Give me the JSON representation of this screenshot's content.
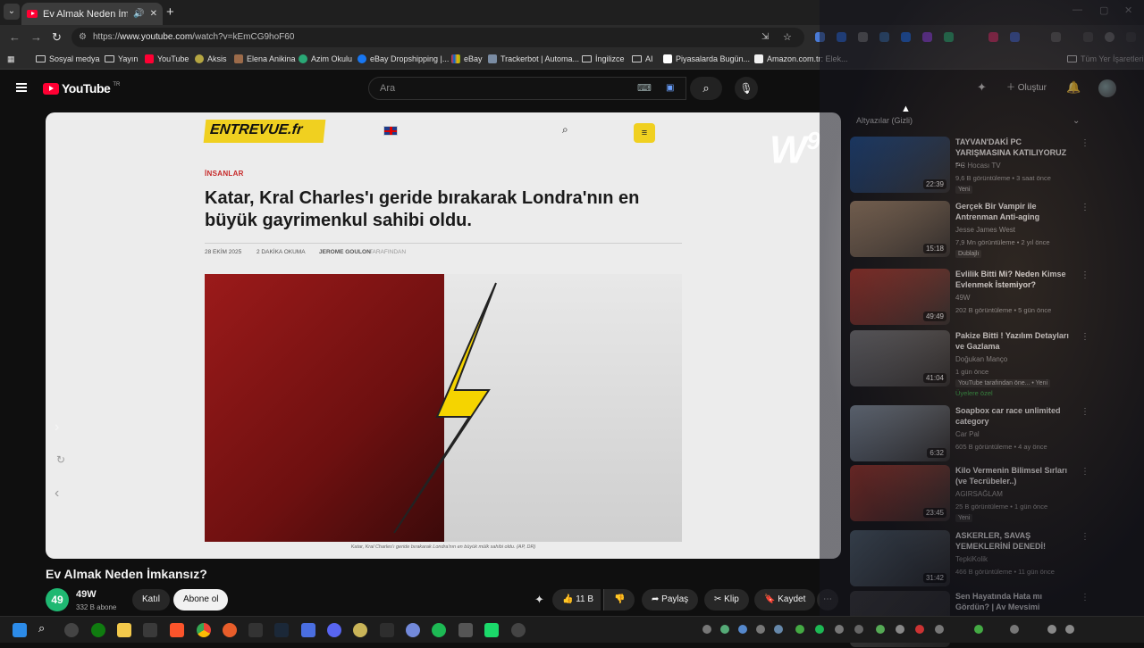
{
  "browser": {
    "tab_title": "Ev Almak Neden İmkansız?",
    "url_prefix": "https://",
    "url_domain": "www.youtube.com",
    "url_path": "/watch?v=kEmCG9hoF60",
    "bookmarks": [
      {
        "label": "Sosyal medya"
      },
      {
        "label": "Yayın"
      },
      {
        "label": "YouTube"
      },
      {
        "label": "Aksis"
      },
      {
        "label": "Elena Anikina"
      },
      {
        "label": "Azim Okulu"
      },
      {
        "label": "eBay Dropshipping |..."
      },
      {
        "label": "eBay"
      },
      {
        "label": "Trackerbot | Automa..."
      },
      {
        "label": "İngilizce"
      },
      {
        "label": "AI"
      },
      {
        "label": "Piyasalarda Bugün..."
      },
      {
        "label": "Amazon.com.tr: Elek..."
      },
      {
        "label": "Tüm Yer İşaretleri"
      }
    ]
  },
  "youtube": {
    "logo_text": "YouTube",
    "logo_region": "TR",
    "search_placeholder": "Ara",
    "create_label": "Oluştur"
  },
  "article": {
    "site_name": "ENTREVUE.fr",
    "category": "İNSANLAR",
    "headline": "Katar, Kral Charles'ı geride bırakarak Londra'nın en büyük gayrimenkul sahibi oldu.",
    "date": "28 EKİM 2025",
    "read_time": "2 DAKİKA OKUMA",
    "author": "JEROME GOULON",
    "author_suffix": "TARAFINDAN",
    "caption": "Katar, Kral Charles'ı geride bırakarak Londra'nın en büyük mülk sahibi oldu. (AP, DR)"
  },
  "video": {
    "title": "Ev Almak Neden İmkansız?",
    "channel_initials": "49",
    "channel_name": "49W",
    "subscribers": "332 B abone",
    "join_label": "Katıl",
    "subscribe_label": "Abone ol",
    "likes": "11 B",
    "share_label": "Paylaş",
    "clip_label": "Klip",
    "save_label": "Kaydet"
  },
  "sidebar": {
    "header": "Altyazılar (Gizli)",
    "items": [
      {
        "title": "TAYVAN'DAKİ PC YARIŞMASINA KATILIYORUZ -...",
        "channel": "PC Hocası TV",
        "meta": "9,6 B görüntüleme • 3 saat önce",
        "badge": "Yeni",
        "duration": "22:39",
        "thumb_color": "#1e5aa8"
      },
      {
        "title": "Gerçek Bir Vampir ile Antrenman Anti-aging",
        "channel": "Jesse James West",
        "meta": "7,9 Mn görüntüleme • 2 yıl önce",
        "badge": "Dublajlı",
        "duration": "15:18",
        "thumb_color": "#c8a27a"
      },
      {
        "title": "Evlilik Bitti Mi? Neden Kimse Evlenmek İstemiyor?",
        "channel": "49W",
        "meta": "202 B görüntüleme • 5 gün önce",
        "badge": "",
        "duration": "49:49",
        "thumb_color": "#d13a2a"
      },
      {
        "title": "Pakize Bitti ! Yazılım Detayları ve Gazlama",
        "channel": "Doğukan Manço",
        "meta": "1 gün önce",
        "badge": "YouTube tarafından öne... • Yeni",
        "extra": "Üyelere özel",
        "duration": "41:04",
        "thumb_color": "#8a8a8a"
      },
      {
        "title": "Soapbox car race unlimited category",
        "channel": "Car Pal",
        "meta": "605 B görüntüleme • 4 ay önce",
        "badge": "",
        "duration": "6:32",
        "thumb_color": "#9fb0bf"
      },
      {
        "title": "Kilo Vermenin Bilimsel Sırları (ve Tecrübeler..)",
        "channel": "AGIRSAĞLAM",
        "meta": "25 B görüntüleme • 1 gün önce",
        "badge": "Yeni",
        "duration": "23:45",
        "thumb_color": "#c83b2a"
      },
      {
        "title": "ASKERLER, SAVAŞ YEMEKLERİNİ DENEDİ!",
        "channel": "TepkiKolik",
        "meta": "466 B görüntüleme • 11 gün önce",
        "badge": "",
        "duration": "31:42",
        "thumb_color": "#5a6f7d"
      },
      {
        "title": "Sen Hayatında Hata mı Gördün? | Av Mevsimi",
        "channel": "",
        "meta": "",
        "badge": "",
        "duration": "",
        "thumb_color": "#3a3a3a"
      }
    ]
  },
  "colors": {
    "yt_red": "#ff0033",
    "entrevue_yellow": "#f0d020",
    "background": "#0f0f0f"
  }
}
